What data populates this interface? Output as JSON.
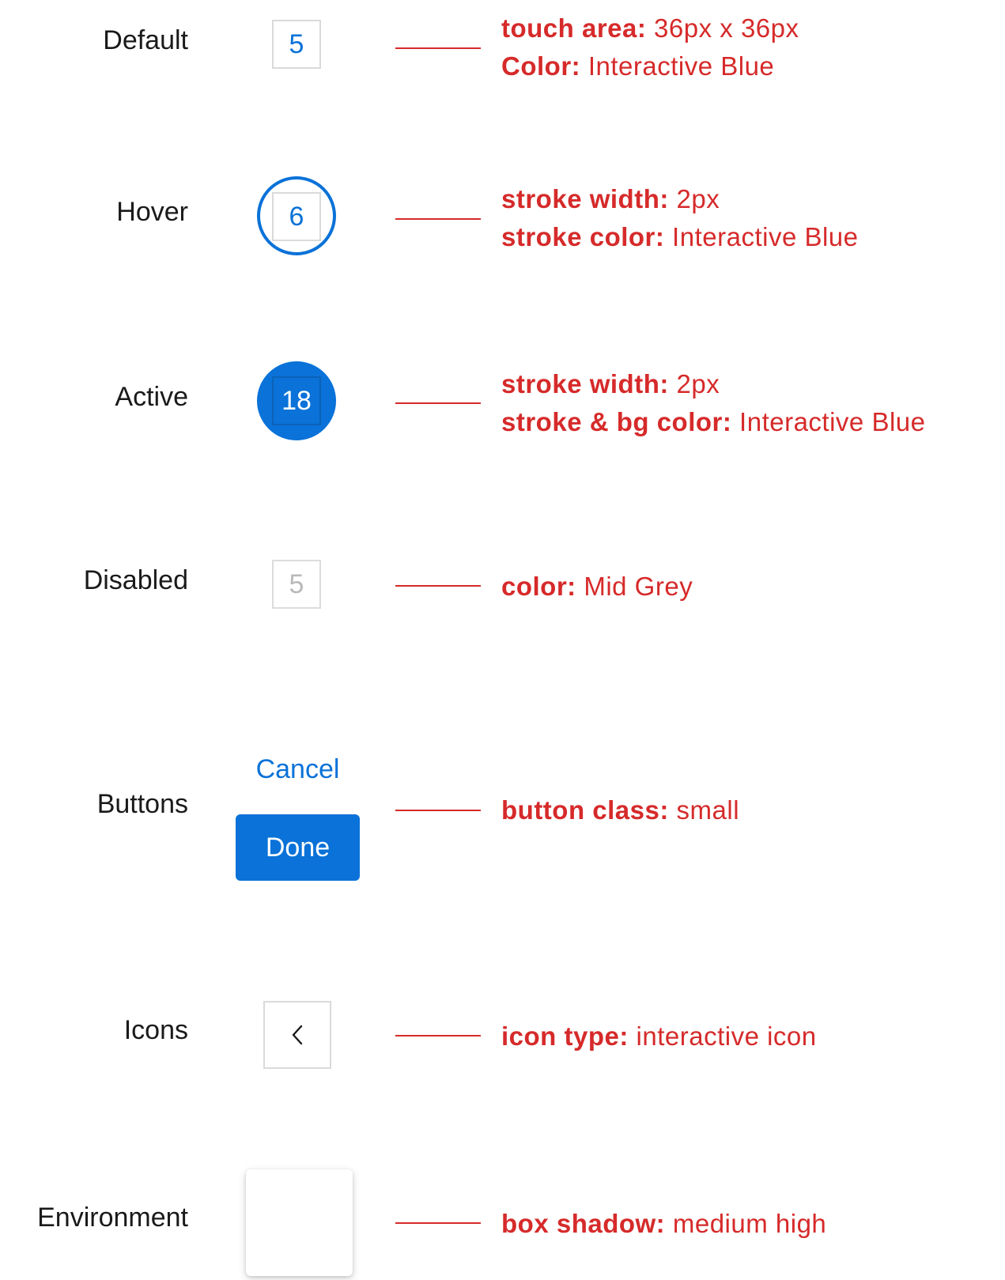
{
  "colors": {
    "interactive_blue": "#0a72d8",
    "annotation_red": "#d62a2a",
    "mid_grey": "#b9b9b9"
  },
  "rows": {
    "default": {
      "label": "Default",
      "day": "5",
      "spec1_key": "touch area:",
      "spec1_val": " 36px x 36px",
      "spec2_key": "Color:",
      "spec2_val": " Interactive Blue"
    },
    "hover": {
      "label": "Hover",
      "day": "6",
      "spec1_key": "stroke width:",
      "spec1_val": " 2px",
      "spec2_key": "stroke color:",
      "spec2_val": " Interactive Blue"
    },
    "active": {
      "label": "Active",
      "day": "18",
      "spec1_key": "stroke width:",
      "spec1_val": " 2px",
      "spec2_key": "stroke & bg color:",
      "spec2_val": " Interactive Blue"
    },
    "disabled": {
      "label": "Disabled",
      "day": "5",
      "spec1_key": "color:",
      "spec1_val": " Mid Grey"
    },
    "buttons": {
      "label": "Buttons",
      "cancel_label": "Cancel",
      "done_label": "Done",
      "spec1_key": "button class:",
      "spec1_val": " small"
    },
    "icons": {
      "label": "Icons",
      "icon": "chevron-left-icon",
      "spec1_key": "icon type:",
      "spec1_val": " interactive icon"
    },
    "environment": {
      "label": "Environment",
      "spec1_key": "box shadow:",
      "spec1_val": " medium high"
    }
  }
}
